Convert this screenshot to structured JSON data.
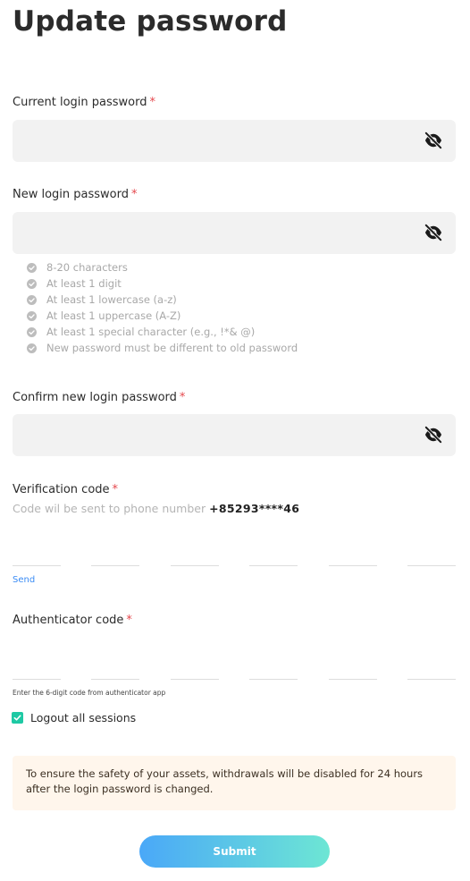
{
  "page": {
    "title": "Update password"
  },
  "current_password": {
    "label": "Current login password",
    "required_mark": "*",
    "value": ""
  },
  "new_password": {
    "label": "New login password",
    "required_mark": "*",
    "value": "",
    "rules": [
      "8-20 characters",
      "At least 1 digit",
      "At least 1 lowercase (a-z)",
      "At least 1 uppercase (A-Z)",
      "At least 1 special character (e.g., !*& @)",
      "New password must be different to old password"
    ]
  },
  "confirm_password": {
    "label": "Confirm new login password",
    "required_mark": "*",
    "value": ""
  },
  "verification": {
    "label": "Verification code",
    "required_mark": "*",
    "hint_prefix": "Code wil be sent to phone number",
    "phone": "+85293****46",
    "send_label": "Send"
  },
  "authenticator": {
    "label": "Authenticator code",
    "required_mark": "*",
    "note": "Enter the 6-digit code from authenticator app"
  },
  "logout": {
    "label": "Logout all sessions",
    "checked": true
  },
  "notice": {
    "text": "To ensure the safety of your assets, withdrawals will be disabled for 24 hours after the login password is changed."
  },
  "submit": {
    "label": "Submit"
  },
  "icons": {
    "visibility_toggle": "eye-off-icon",
    "rule_check": "check-circle-icon",
    "checkbox": "checkmark-icon"
  },
  "colors": {
    "required": "#e5484d",
    "link": "#3b8cf5",
    "checkbox": "#1ec9a4",
    "notice_bg": "#fff6ec",
    "button_from": "#4aa8f8",
    "button_to": "#6de6d4"
  }
}
